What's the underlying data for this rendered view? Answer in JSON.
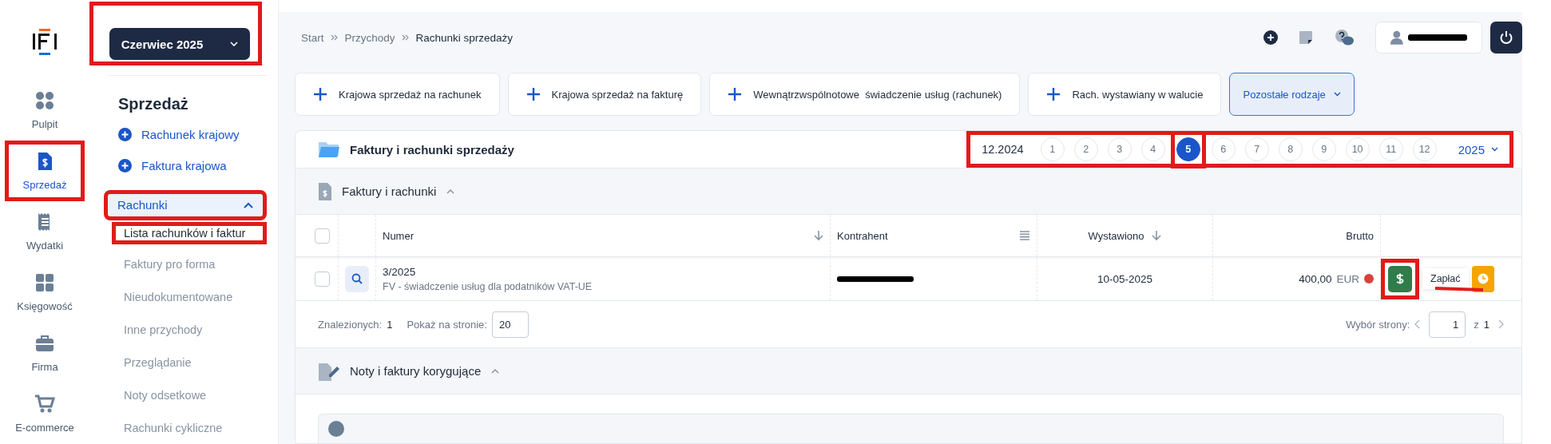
{
  "rail": {
    "items": [
      {
        "label": "Pulpit",
        "selected": false,
        "highlighted": false
      },
      {
        "label": "Sprzedaż",
        "selected": true,
        "highlighted": true
      },
      {
        "label": "Wydatki",
        "selected": false,
        "highlighted": false
      },
      {
        "label": "Księgowość",
        "selected": false,
        "highlighted": false
      },
      {
        "label": "Firma",
        "selected": false,
        "highlighted": false
      },
      {
        "label": "E-commerce",
        "selected": false,
        "highlighted": false
      }
    ]
  },
  "sidebar": {
    "period": {
      "label": "Czerwiec 2025",
      "highlighted": true
    },
    "heading": "Sprzedaż",
    "quick_links": [
      "Rachunek krajowy",
      "Faktura krajowa"
    ],
    "group": {
      "label": "Rachunki",
      "expanded": true,
      "highlighted": true,
      "children": [
        {
          "label": "Lista rachunków i faktur",
          "selected": true,
          "highlighted": true
        },
        {
          "label": "Faktury pro forma",
          "selected": false,
          "highlighted": false
        },
        {
          "label": "Nieudokumentowane",
          "selected": false,
          "highlighted": false
        },
        {
          "label": "Inne przychody",
          "selected": false,
          "highlighted": false
        },
        {
          "label": "Przeglądanie",
          "selected": false,
          "highlighted": false
        },
        {
          "label": "Noty odsetkowe",
          "selected": false,
          "highlighted": false
        },
        {
          "label": "Rachunki cykliczne",
          "selected": false,
          "highlighted": false
        }
      ]
    }
  },
  "breadcrumb": [
    "Start",
    "Przychody",
    "Rachunki sprzedaży"
  ],
  "actions": [
    {
      "label": "Krajowa sprzedaż na rachunek",
      "kind": "add"
    },
    {
      "label": "Krajowa sprzedaż na fakturę",
      "kind": "add"
    },
    {
      "label": "Wewnątrzwspólnotowe  świadczenie usług (rachunek)",
      "kind": "add"
    },
    {
      "label": "Rach. wystawiany w walucie",
      "kind": "add"
    },
    {
      "label": "Pozostałe rodzaje",
      "kind": "menu"
    }
  ],
  "panel": {
    "title": "Faktury i rachunki sprzedaży",
    "previous": "12.2024",
    "highlighted": true,
    "months": [
      {
        "label": "1",
        "selected": false,
        "highlighted": false
      },
      {
        "label": "2",
        "selected": false,
        "highlighted": false
      },
      {
        "label": "3",
        "selected": false,
        "highlighted": false
      },
      {
        "label": "4",
        "selected": false,
        "highlighted": false
      },
      {
        "label": "5",
        "selected": true,
        "highlighted": true
      },
      {
        "label": "6",
        "selected": false,
        "highlighted": false
      },
      {
        "label": "7",
        "selected": false,
        "highlighted": false
      },
      {
        "label": "8",
        "selected": false,
        "highlighted": false
      },
      {
        "label": "9",
        "selected": false,
        "highlighted": false
      },
      {
        "label": "10",
        "selected": false,
        "highlighted": false
      },
      {
        "label": "11",
        "selected": false,
        "highlighted": false
      },
      {
        "label": "12",
        "selected": false,
        "highlighted": false
      }
    ],
    "year": "2025"
  },
  "section": {
    "title": "Faktury i rachunki",
    "expanded": true
  },
  "table": {
    "all_checked": false,
    "columns": [
      {
        "label": "Numer",
        "kind": "sort"
      },
      {
        "label": "Kontrahent",
        "kind": "filter"
      },
      {
        "label": "Wystawiono",
        "kind": "sort"
      },
      {
        "label": "Brutto",
        "kind": "plain"
      }
    ],
    "rows": [
      {
        "checked": false,
        "number": "3/2025",
        "description": "FV - świadczenie usług dla podatników VAT-UE",
        "contractor_redacted": true,
        "issued": "10-05-2025",
        "amount": "400,00",
        "currency": "EUR",
        "color": "#d9423a",
        "pay_highlighted": true,
        "tooltip": {
          "label": "Zapłać",
          "highlighted": true
        }
      }
    ]
  },
  "footer": {
    "found_label": "Znalezionych:",
    "found": "1",
    "per_page_label": "Pokaż na stronie:",
    "per_page": "20",
    "page_label": "Wybór strony:",
    "page": "1",
    "of": "z",
    "pages": "1"
  },
  "section2": {
    "title": "Noty i faktury korygujące",
    "expanded": true
  }
}
